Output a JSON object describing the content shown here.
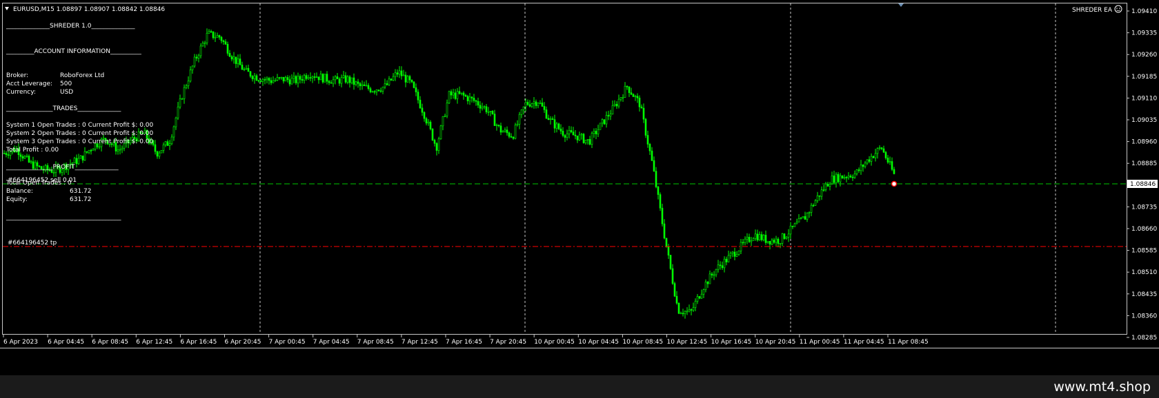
{
  "header": {
    "symbol_info": "EURUSD,M15  1.08897 1.08907 1.08842 1.08846",
    "ea_name": "SHREDER EA",
    "ea_icon": "smiley-icon"
  },
  "panel": {
    "title": "______________SHREDER 1.0______________",
    "account_heading": "_________ACCOUNT INFORMATION__________",
    "broker_label": "Broker:",
    "broker_value": "RoboForex Ltd",
    "leverage_label": "Acct Leverage:",
    "leverage_value": "500",
    "currency_label": "Currency:",
    "currency_value": "USD",
    "trades_heading": "_______________TRADES______________",
    "sys1": "System 1 Open Trades :  0   Current Profit $:  0.00",
    "sys2": "System 2 Open Trades :  0   Current Profit $:  0.00",
    "sys3": "System 3 Open Trades :  0   Current Profit $:  0.00",
    "total_profit": "Total Profit           :  0.00",
    "profit_heading": "_______________PROFIT______________",
    "total_open": "Total Open Trades :   0",
    "balance_label": "Balance:",
    "balance_value": "631.72",
    "equity_label": "Equity:",
    "equity_value": "631.72",
    "footer_line": "_____________________________________"
  },
  "orders": {
    "sell_label": "#664196452 sell 0.01",
    "tp_label": "#664196452 tp"
  },
  "colors": {
    "candle": "#00ff00",
    "sell_line": "#00c800",
    "tp_line": "#ff0000",
    "grid": "#c8c8c8"
  },
  "price_axis": {
    "ticks": [
      "1.09410",
      "1.09335",
      "1.09260",
      "1.09185",
      "1.09110",
      "1.09035",
      "1.08960",
      "1.08885",
      "1.08810",
      "1.08735",
      "1.08660",
      "1.08585",
      "1.08510",
      "1.08435",
      "1.08360",
      "1.08285"
    ],
    "current_price": "1.08846"
  },
  "time_axis": {
    "ticks": [
      "6 Apr 2023",
      "6 Apr 04:45",
      "6 Apr 08:45",
      "6 Apr 12:45",
      "6 Apr 16:45",
      "6 Apr 20:45",
      "7 Apr 00:45",
      "7 Apr 04:45",
      "7 Apr 08:45",
      "7 Apr 12:45",
      "7 Apr 16:45",
      "7 Apr 20:45",
      "10 Apr 00:45",
      "10 Apr 04:45",
      "10 Apr 08:45",
      "10 Apr 12:45",
      "10 Apr 16:45",
      "10 Apr 20:45",
      "11 Apr 00:45",
      "11 Apr 04:45",
      "11 Apr 08:45"
    ]
  },
  "price_path": [
    [
      0,
      1.0892
    ],
    [
      1,
      1.08935
    ],
    [
      2,
      1.08885
    ],
    [
      3,
      1.08865
    ],
    [
      4,
      1.0886
    ],
    [
      5,
      1.0888
    ],
    [
      6,
      1.089
    ],
    [
      7,
      1.08945
    ],
    [
      8,
      1.0897
    ],
    [
      9,
      1.0893
    ],
    [
      10,
      1.08965
    ],
    [
      11,
      1.0899
    ],
    [
      12,
      1.0892
    ],
    [
      13,
      1.0896
    ],
    [
      14,
      1.0912
    ],
    [
      15,
      1.0924
    ],
    [
      16,
      1.0933
    ],
    [
      17,
      1.0932
    ],
    [
      18,
      1.0925
    ],
    [
      19,
      1.092
    ],
    [
      20,
      1.0918
    ],
    [
      21,
      1.0917
    ],
    [
      22,
      1.09175
    ],
    [
      23,
      1.0917
    ],
    [
      24,
      1.09195
    ],
    [
      25,
      1.0918
    ],
    [
      26,
      1.0917
    ],
    [
      27,
      1.09175
    ],
    [
      28,
      1.0915
    ],
    [
      29,
      1.0914
    ],
    [
      30,
      1.0915
    ],
    [
      31,
      1.092
    ],
    [
      32,
      1.0916
    ],
    [
      33,
      1.0906
    ],
    [
      34,
      1.0894
    ],
    [
      35,
      1.0912
    ],
    [
      36,
      1.0912
    ],
    [
      37,
      1.091
    ],
    [
      38,
      1.0907
    ],
    [
      39,
      1.09
    ],
    [
      40,
      1.0898
    ],
    [
      41,
      1.0909
    ],
    [
      42,
      1.091
    ],
    [
      43,
      1.0903
    ],
    [
      44,
      1.0899
    ],
    [
      45,
      1.0898
    ],
    [
      46,
      1.0896
    ],
    [
      47,
      1.0902
    ],
    [
      48,
      1.0908
    ],
    [
      49,
      1.0915
    ],
    [
      50,
      1.0909
    ],
    [
      51,
      1.0888
    ],
    [
      52,
      1.0862
    ],
    [
      53,
      1.0838
    ],
    [
      54,
      1.0837
    ],
    [
      55,
      1.0846
    ],
    [
      56,
      1.0852
    ],
    [
      57,
      1.0856
    ],
    [
      58,
      1.086
    ],
    [
      59,
      1.0864
    ],
    [
      60,
      1.0862
    ],
    [
      61,
      1.0862
    ],
    [
      62,
      1.0866
    ],
    [
      63,
      1.087
    ],
    [
      64,
      1.0877
    ],
    [
      65,
      1.0883
    ],
    [
      66,
      1.0884
    ],
    [
      67,
      1.0885
    ],
    [
      68,
      1.089
    ],
    [
      69,
      1.0894
    ],
    [
      70,
      1.08846
    ]
  ]
}
